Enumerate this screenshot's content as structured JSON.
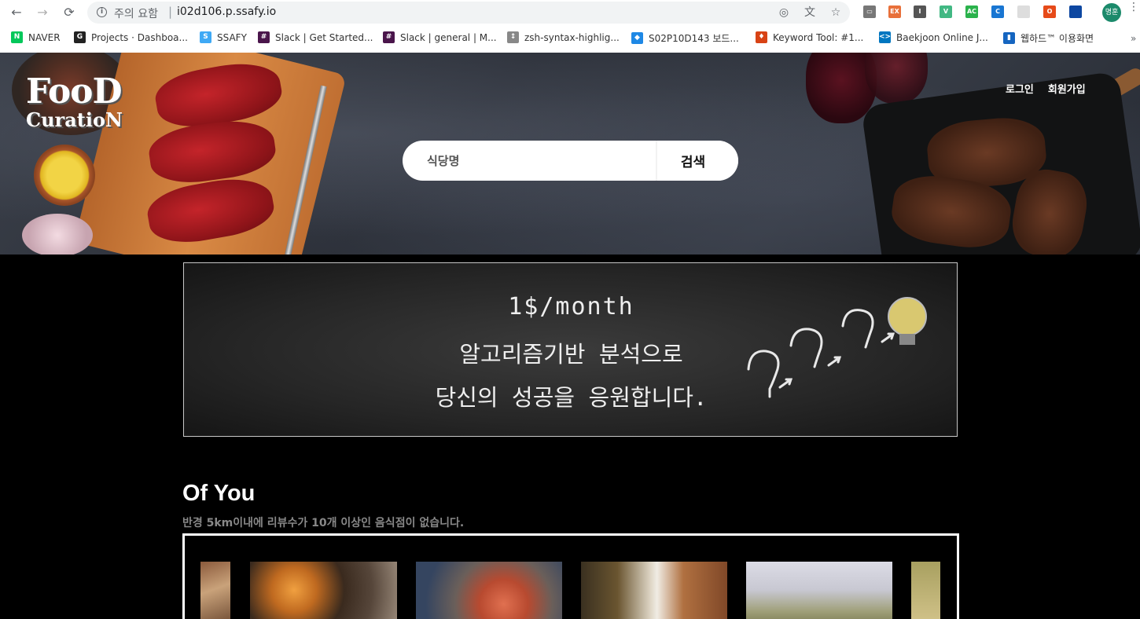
{
  "browser": {
    "url_warning": "주의 요함",
    "url_separator": "|",
    "url": "i02d106.p.ssafy.io",
    "profile_label": "명훈",
    "extensions": [
      "EX",
      "I",
      "V",
      "AC",
      "C",
      "O"
    ]
  },
  "bookmarks": [
    {
      "label": "NAVER",
      "icon": "N",
      "color": "#03c75a"
    },
    {
      "label": "Projects · Dashboa...",
      "icon": "G",
      "color": "#222222"
    },
    {
      "label": "SSAFY",
      "icon": "S",
      "color": "#3fa9f5"
    },
    {
      "label": "Slack | Get Started...",
      "icon": "#",
      "color": "#4a154b"
    },
    {
      "label": "Slack | general | M...",
      "icon": "#",
      "color": "#4a154b"
    },
    {
      "label": "zsh-syntax-highlig...",
      "icon": "↕",
      "color": "#888888"
    },
    {
      "label": "S02P10D143 보드...",
      "icon": "◆",
      "color": "#1e88e5"
    },
    {
      "label": "Keyword Tool: #1...",
      "icon": "♦",
      "color": "#d84315"
    },
    {
      "label": "Baekjoon Online J...",
      "icon": "<>",
      "color": "#0076c0"
    },
    {
      "label": "웹하드™ 이용화면",
      "icon": "▮",
      "color": "#1565c0"
    }
  ],
  "header": {
    "logo_top": "FooD",
    "logo_bottom": "CuratioN",
    "login": "로그인",
    "signup": "회원가입",
    "search_placeholder": "식당명",
    "search_button": "검색"
  },
  "banner": {
    "line1": "1$/month",
    "line2": "알고리즘기반 분석으로",
    "line3": "당신의 성공을 응원합니다."
  },
  "of_you": {
    "title": "Of You",
    "note": "반경 5km이내에 리뷰수가 10개 이상인 음식점이 없습니다."
  }
}
